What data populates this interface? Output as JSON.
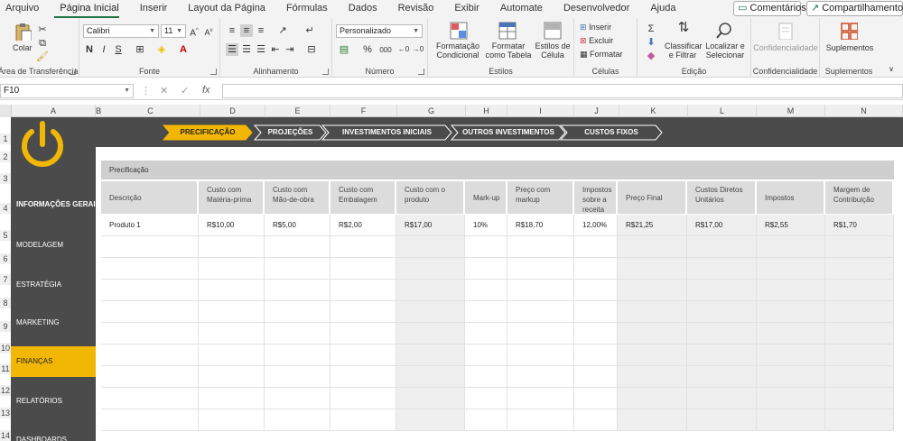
{
  "tabs": [
    "Arquivo",
    "Página Inicial",
    "Inserir",
    "Layout da Página",
    "Fórmulas",
    "Dados",
    "Revisão",
    "Exibir",
    "Automate",
    "Desenvolvedor",
    "Ajuda"
  ],
  "tab_active": "Página Inicial",
  "comments_label": "Comentários",
  "share_label": "Compartilhamento",
  "ribbon": {
    "clipboard": {
      "paste": "Colar",
      "label": "Área de Transferência"
    },
    "font": {
      "name": "Calibri",
      "size": "11",
      "label": "Fonte",
      "bold": "N",
      "italic": "I",
      "underline": "S"
    },
    "alignment": {
      "label": "Alinhamento"
    },
    "number": {
      "format": "Personalizado",
      "label": "Número",
      "percent": "%",
      "thousands": "000"
    },
    "styles": {
      "conditional": "Formatação Condicional",
      "table": "Formatar como Tabela",
      "cell": "Estilos de Célula",
      "label": "Estilos"
    },
    "cells": {
      "insert": "Inserir",
      "delete": "Excluir",
      "format": "Formatar",
      "label": "Células"
    },
    "editing": {
      "sort": "Classificar e Filtrar",
      "find": "Localizar e Selecionar",
      "label": "Edição"
    },
    "sensitivity": {
      "btn": "Confidencialidade",
      "label": "Confidencialidade"
    },
    "addins": {
      "btn": "Suplementos",
      "label": "Suplementos"
    }
  },
  "formula_bar": {
    "name_box": "F10",
    "fx": "fx",
    "content": ""
  },
  "columns": [
    "A",
    "B",
    "C",
    "D",
    "E",
    "F",
    "G",
    "H",
    "I",
    "J",
    "K",
    "L",
    "M",
    "N"
  ],
  "rows": [
    "1",
    "2",
    "3",
    "4",
    "5",
    "6",
    "7",
    "8",
    "9",
    "10",
    "11",
    "12",
    "13",
    "14"
  ],
  "sidebar": {
    "info": "INFORMAÇÕES GERAIS",
    "items": [
      "MODELAGEM",
      "ESTRATÉGIA",
      "MARKETING",
      "FINANÇAS",
      "RELATÓRIOS",
      "DASHBOARDS"
    ],
    "active": "FINANÇAS"
  },
  "nav_tabs": [
    "PRECIFICAÇÃO",
    "PROJEÇÕES",
    "INVESTIMENTOS INICIAIS",
    "OUTROS INVESTIMENTOS",
    "CUSTOS FIXOS"
  ],
  "nav_active": "PRECIFICAÇÃO",
  "table": {
    "title": "Precificação",
    "headers": [
      "Descrição",
      "Custo com Matéria-prima",
      "Custo com Mão-de-obra",
      "Custo com Embalagem",
      "Custo com o produto",
      "Mark-up",
      "Preço com markup",
      "Impostos sobre a receita",
      "Preço Final",
      "Custos Diretos Unitários",
      "Impostos",
      "Margem de Contribuição"
    ],
    "rows": [
      [
        "Produto 1",
        "R$10,00",
        "R$5,00",
        "R$2,00",
        "R$17,00",
        "10%",
        "R$18,70",
        "12,00%",
        "R$21,25",
        "R$17,00",
        "R$2,55",
        "R$1,70"
      ]
    ]
  },
  "colors": {
    "accent": "#f2b705",
    "dark": "#4b4b4b",
    "excel_green": "#217346"
  }
}
